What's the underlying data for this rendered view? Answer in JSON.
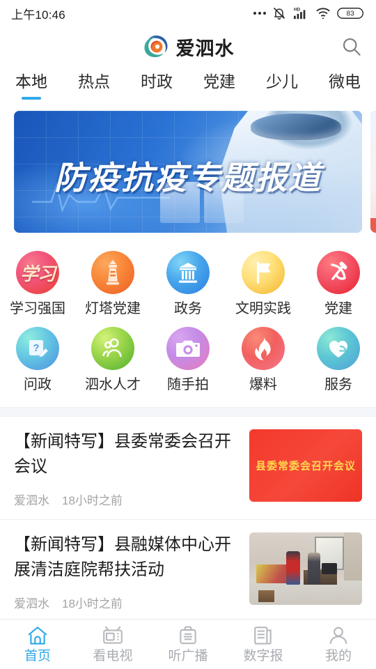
{
  "status_bar": {
    "time": "上午10:46",
    "battery": "83",
    "icons": [
      "more-dots-icon",
      "bell-muted-icon",
      "hd-signal-icon",
      "wifi-icon",
      "battery-icon"
    ]
  },
  "header": {
    "logo": "app-logo-swirl",
    "title": "爱泗水",
    "search_icon": "search-icon"
  },
  "tabs": {
    "active_index": 0,
    "items": [
      {
        "label": "本地"
      },
      {
        "label": "热点"
      },
      {
        "label": "时政"
      },
      {
        "label": "党建"
      },
      {
        "label": "少儿"
      },
      {
        "label": "微电"
      }
    ]
  },
  "banner": {
    "caption": "防疫抗疫专题报道"
  },
  "shortcuts": {
    "row1": [
      {
        "label": "学习强国",
        "icon": "xuexi-qiangguo-icon",
        "glyph": "学习",
        "color_from": "#f2547a",
        "color_to": "#e8402c"
      },
      {
        "label": "灯塔党建",
        "icon": "lighthouse-icon",
        "glyph": "",
        "color_from": "#f98a3c",
        "color_to": "#ee5d22"
      },
      {
        "label": "政务",
        "icon": "government-building-icon",
        "glyph": "",
        "color_from": "#5ec4f0",
        "color_to": "#2e7fe0"
      },
      {
        "label": "文明实践",
        "icon": "flag-icon",
        "glyph": "",
        "color_from": "#ffe07a",
        "color_to": "#f2b52c"
      },
      {
        "label": "党建",
        "icon": "hammer-sickle-icon",
        "glyph": "",
        "color_from": "#f4566a",
        "color_to": "#e8202c"
      }
    ],
    "row2": [
      {
        "label": "问政",
        "icon": "question-note-pencil-icon",
        "glyph": "",
        "color_from": "#7fe3d8",
        "color_to": "#4e8fe0"
      },
      {
        "label": "泗水人才",
        "icon": "people-icon",
        "glyph": "",
        "color_from": "#b6e24a",
        "color_to": "#4fae2e"
      },
      {
        "label": "随手拍",
        "icon": "camera-icon",
        "glyph": "",
        "color_from": "#c48ce8",
        "color_to": "#e87ab8"
      },
      {
        "label": "爆料",
        "icon": "flame-icon",
        "glyph": "",
        "color_from": "#f2605e",
        "color_to": "#f4768f"
      },
      {
        "label": "服务",
        "icon": "hands-heart-icon",
        "glyph": "",
        "color_from": "#6fd8c8",
        "color_to": "#4fa8d8"
      }
    ]
  },
  "news": [
    {
      "title": "【新闻特写】县委常委会召开会议",
      "source": "爱泗水",
      "time": "18小时之前",
      "thumb_type": "red-banner",
      "thumb_text": "县委常委会召开会议"
    },
    {
      "title": "【新闻特写】县融媒体中心开展清洁庭院帮扶活动",
      "source": "爱泗水",
      "time": "18小时之前",
      "thumb_type": "photo-room",
      "thumb_text": ""
    }
  ],
  "bottom_nav": {
    "active_index": 0,
    "items": [
      {
        "label": "首页",
        "icon": "home-icon"
      },
      {
        "label": "看电视",
        "icon": "tv-icon"
      },
      {
        "label": "听广播",
        "icon": "radio-icon"
      },
      {
        "label": "数字报",
        "icon": "newspaper-icon"
      },
      {
        "label": "我的",
        "icon": "person-icon"
      }
    ]
  },
  "colors": {
    "accent": "#2fa8e8",
    "text_primary": "#1c1c1c",
    "text_muted": "#a3a3a3"
  }
}
